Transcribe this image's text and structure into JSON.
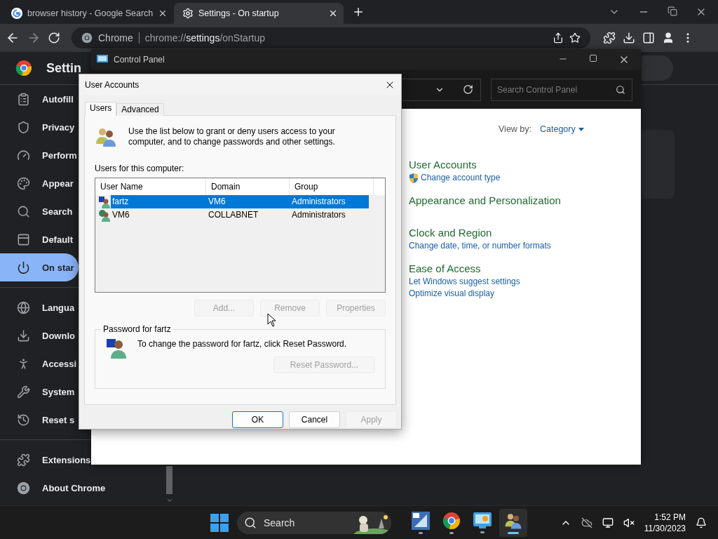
{
  "browser": {
    "tabs": [
      {
        "title": "browser history - Google Search",
        "selected": false
      },
      {
        "title": "Settings - On startup",
        "selected": true
      }
    ],
    "omnibox": {
      "site": "Chrome",
      "url": "chrome://**settings**/onStartup"
    },
    "settings": {
      "title": "Settin",
      "groups": [
        [
          {
            "label": "Autofill",
            "selected": false
          },
          {
            "label": "Privacy",
            "selected": false
          },
          {
            "label": "Perform",
            "selected": false
          },
          {
            "label": "Appear",
            "selected": false
          },
          {
            "label": "Search",
            "selected": false
          },
          {
            "label": "Default",
            "selected": false
          },
          {
            "label": "On star",
            "selected": true
          }
        ],
        [
          {
            "label": "Langua",
            "selected": false
          },
          {
            "label": "Downlo",
            "selected": false
          },
          {
            "label": "Accessi",
            "selected": false
          },
          {
            "label": "System",
            "selected": false
          },
          {
            "label": "Reset s",
            "selected": false
          }
        ],
        [
          {
            "label": "Extensions",
            "selected": false
          },
          {
            "label": "About Chrome",
            "selected": false
          }
        ]
      ]
    }
  },
  "control_panel": {
    "title": "Control Panel",
    "search": {
      "placeholder": "Search Control Panel"
    },
    "view_by": {
      "label": "View by:",
      "value": "Category"
    },
    "categories": [
      {
        "title": "User Accounts",
        "links": [
          {
            "text": "Change account type",
            "kind": "shield"
          }
        ]
      },
      {
        "title": "Appearance and Personalization"
      },
      {
        "title": "Clock and Region",
        "links": [
          {
            "text": "Change date, time, or number formats",
            "kind": "plain"
          }
        ]
      },
      {
        "title": "Ease of Access",
        "links": [
          {
            "text": "Let Windows suggest settings",
            "kind": "plain"
          },
          {
            "text": "Optimize visual display",
            "kind": "plain"
          }
        ]
      }
    ]
  },
  "dialog": {
    "title": "User Accounts",
    "tabs": [
      {
        "label": "Users",
        "selected": true
      },
      {
        "label": "Advanced",
        "selected": false
      }
    ],
    "intro": "Use the list below to grant or deny users access to your computer, and to change passwords and other settings.",
    "list_label": "Users for this computer:",
    "columns": [
      "User Name",
      "Domain",
      "Group"
    ],
    "rows": [
      {
        "cells": [
          "fartz",
          "VM6",
          "Administrators"
        ],
        "selected": true
      },
      {
        "cells": [
          "VM6",
          "COLLABNET",
          "Administrators"
        ],
        "selected": false
      }
    ],
    "list_buttons": [
      {
        "label": "Add...",
        "disabled": true
      },
      {
        "label": "Remove",
        "disabled": true
      },
      {
        "label": "Properties",
        "disabled": true
      }
    ],
    "password": {
      "legend": "Password for fartz",
      "text": "To change the password for fartz, click Reset Password.",
      "button": {
        "label": "Reset Password...",
        "disabled": true
      }
    },
    "buttons": [
      {
        "label": "OK",
        "disabled": false
      },
      {
        "label": "Cancel",
        "disabled": false
      },
      {
        "label": "Apply",
        "disabled": true
      }
    ]
  },
  "taskbar": {
    "search": {
      "placeholder": "Search"
    },
    "apps": [
      {
        "selected": false
      },
      {
        "selected": false
      },
      {
        "selected": false
      },
      {
        "selected": true
      }
    ],
    "time": "1:52 PM",
    "date": "11/30/2023"
  }
}
